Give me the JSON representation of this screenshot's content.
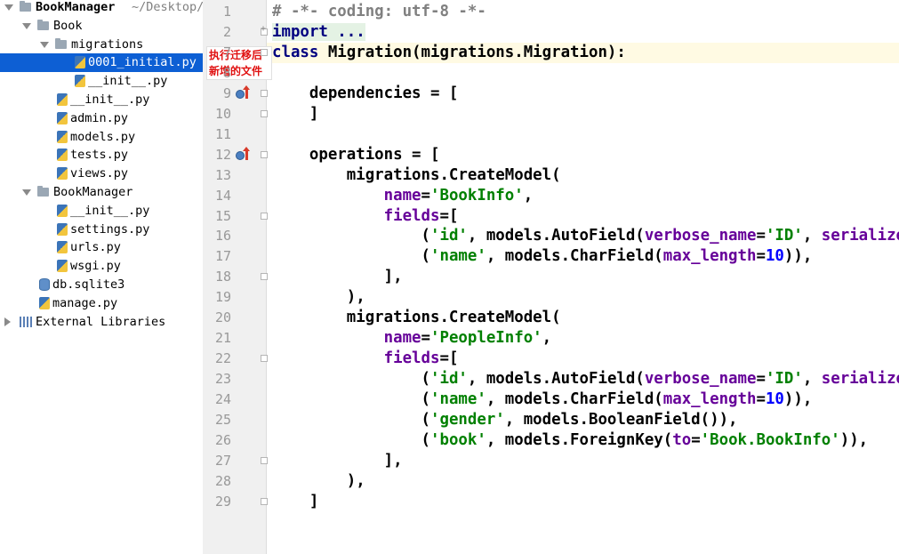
{
  "project_tree": [
    {
      "label": "BookManager",
      "detail": "~/Desktop/",
      "indent": 0,
      "kind": "folder",
      "expanded": true,
      "root": true,
      "selected": false,
      "name": "tree-root-bookmanager"
    },
    {
      "label": "Book",
      "indent": 1,
      "kind": "folder",
      "expanded": true,
      "selected": false,
      "name": "tree-folder-book"
    },
    {
      "label": "migrations",
      "indent": 2,
      "kind": "folder",
      "expanded": true,
      "selected": false,
      "name": "tree-folder-migrations"
    },
    {
      "label": "0001_initial.py",
      "indent": 4,
      "kind": "py",
      "selected": true,
      "name": "tree-file-0001-initial"
    },
    {
      "label": "__init__.py",
      "indent": 4,
      "kind": "py",
      "selected": false,
      "name": "tree-file-migrations-init"
    },
    {
      "label": "__init__.py",
      "indent": 3,
      "kind": "py",
      "selected": false,
      "name": "tree-file-book-init"
    },
    {
      "label": "admin.py",
      "indent": 3,
      "kind": "py",
      "selected": false,
      "name": "tree-file-admin"
    },
    {
      "label": "models.py",
      "indent": 3,
      "kind": "py",
      "selected": false,
      "name": "tree-file-models"
    },
    {
      "label": "tests.py",
      "indent": 3,
      "kind": "py",
      "selected": false,
      "name": "tree-file-tests"
    },
    {
      "label": "views.py",
      "indent": 3,
      "kind": "py",
      "selected": false,
      "name": "tree-file-views"
    },
    {
      "label": "BookManager",
      "indent": 1,
      "kind": "folder",
      "expanded": true,
      "selected": false,
      "name": "tree-folder-bookmanager"
    },
    {
      "label": "__init__.py",
      "indent": 3,
      "kind": "py",
      "selected": false,
      "name": "tree-file-bm-init"
    },
    {
      "label": "settings.py",
      "indent": 3,
      "kind": "py",
      "selected": false,
      "name": "tree-file-settings"
    },
    {
      "label": "urls.py",
      "indent": 3,
      "kind": "py",
      "selected": false,
      "name": "tree-file-urls"
    },
    {
      "label": "wsgi.py",
      "indent": 3,
      "kind": "py",
      "selected": false,
      "name": "tree-file-wsgi"
    },
    {
      "label": "db.sqlite3",
      "indent": 2,
      "kind": "db",
      "selected": false,
      "name": "tree-file-db"
    },
    {
      "label": "manage.py",
      "indent": 2,
      "kind": "py",
      "selected": false,
      "name": "tree-file-manage"
    },
    {
      "label": "External Libraries",
      "indent": 0,
      "kind": "lib",
      "expanded": false,
      "selected": false,
      "name": "tree-external-libraries"
    }
  ],
  "annotation": {
    "line1": "执行迁移后",
    "line2": "新增的文件",
    "color": "#e01010"
  },
  "editor": {
    "highlighted_line": 7,
    "lines": [
      {
        "num": "1",
        "fold": "none",
        "marker": false,
        "tokens": [
          [
            "com",
            "# -*- coding: utf-8 -*-"
          ]
        ]
      },
      {
        "num": "2",
        "fold": "plus",
        "marker": false,
        "tokens": [
          [
            "fold",
            "import ..."
          ]
        ]
      },
      {
        "num": "7",
        "fold": "open",
        "marker": false,
        "tokens": [
          [
            "kw",
            "class "
          ],
          [
            "txt",
            "Migration(migrations.Migration):"
          ]
        ]
      },
      {
        "num": "8",
        "fold": "none",
        "marker": false,
        "tokens": []
      },
      {
        "num": "9",
        "fold": "open",
        "marker": true,
        "tokens": [
          [
            "txt",
            "    dependencies = ["
          ]
        ]
      },
      {
        "num": "10",
        "fold": "close",
        "marker": false,
        "tokens": [
          [
            "txt",
            "    ]"
          ]
        ]
      },
      {
        "num": "11",
        "fold": "none",
        "marker": false,
        "tokens": []
      },
      {
        "num": "12",
        "fold": "open",
        "marker": true,
        "tokens": [
          [
            "txt",
            "    operations = ["
          ]
        ]
      },
      {
        "num": "13",
        "fold": "none",
        "marker": false,
        "tokens": [
          [
            "txt",
            "        migrations.CreateModel("
          ]
        ]
      },
      {
        "num": "14",
        "fold": "none",
        "marker": false,
        "tokens": [
          [
            "kwarg",
            "            name"
          ],
          [
            "txt",
            "="
          ],
          [
            "str",
            "'BookInfo'"
          ],
          [
            "txt",
            ","
          ]
        ]
      },
      {
        "num": "15",
        "fold": "open",
        "marker": false,
        "tokens": [
          [
            "kwarg",
            "            fields"
          ],
          [
            "txt",
            "=["
          ]
        ]
      },
      {
        "num": "16",
        "fold": "none",
        "marker": false,
        "tokens": [
          [
            "txt",
            "                ("
          ],
          [
            "str",
            "'id'"
          ],
          [
            "txt",
            ", models.AutoField("
          ],
          [
            "kwarg",
            "verbose_name"
          ],
          [
            "txt",
            "="
          ],
          [
            "str",
            "'ID'"
          ],
          [
            "txt",
            ", "
          ],
          [
            "kwarg",
            "serialize"
          ]
        ]
      },
      {
        "num": "17",
        "fold": "none",
        "marker": false,
        "tokens": [
          [
            "txt",
            "                ("
          ],
          [
            "str",
            "'name'"
          ],
          [
            "txt",
            ", models.CharField("
          ],
          [
            "kwarg",
            "max_length"
          ],
          [
            "txt",
            "="
          ],
          [
            "num",
            "10"
          ],
          [
            "txt",
            ")),"
          ]
        ]
      },
      {
        "num": "18",
        "fold": "close",
        "marker": false,
        "tokens": [
          [
            "txt",
            "            ],"
          ]
        ]
      },
      {
        "num": "19",
        "fold": "none",
        "marker": false,
        "tokens": [
          [
            "txt",
            "        ),"
          ]
        ]
      },
      {
        "num": "20",
        "fold": "none",
        "marker": false,
        "tokens": [
          [
            "txt",
            "        migrations.CreateModel("
          ]
        ]
      },
      {
        "num": "21",
        "fold": "none",
        "marker": false,
        "tokens": [
          [
            "kwarg",
            "            name"
          ],
          [
            "txt",
            "="
          ],
          [
            "str",
            "'PeopleInfo'"
          ],
          [
            "txt",
            ","
          ]
        ]
      },
      {
        "num": "22",
        "fold": "open",
        "marker": false,
        "tokens": [
          [
            "kwarg",
            "            fields"
          ],
          [
            "txt",
            "=["
          ]
        ]
      },
      {
        "num": "23",
        "fold": "none",
        "marker": false,
        "tokens": [
          [
            "txt",
            "                ("
          ],
          [
            "str",
            "'id'"
          ],
          [
            "txt",
            ", models.AutoField("
          ],
          [
            "kwarg",
            "verbose_name"
          ],
          [
            "txt",
            "="
          ],
          [
            "str",
            "'ID'"
          ],
          [
            "txt",
            ", "
          ],
          [
            "kwarg",
            "serialize"
          ]
        ]
      },
      {
        "num": "24",
        "fold": "none",
        "marker": false,
        "tokens": [
          [
            "txt",
            "                ("
          ],
          [
            "str",
            "'name'"
          ],
          [
            "txt",
            ", models.CharField("
          ],
          [
            "kwarg",
            "max_length"
          ],
          [
            "txt",
            "="
          ],
          [
            "num",
            "10"
          ],
          [
            "txt",
            ")),"
          ]
        ]
      },
      {
        "num": "25",
        "fold": "none",
        "marker": false,
        "tokens": [
          [
            "txt",
            "                ("
          ],
          [
            "str",
            "'gender'"
          ],
          [
            "txt",
            ", models.BooleanField()),"
          ]
        ]
      },
      {
        "num": "26",
        "fold": "none",
        "marker": false,
        "tokens": [
          [
            "txt",
            "                ("
          ],
          [
            "str",
            "'book'"
          ],
          [
            "txt",
            ", models.ForeignKey("
          ],
          [
            "kwarg",
            "to"
          ],
          [
            "txt",
            "="
          ],
          [
            "str",
            "'Book.BookInfo'"
          ],
          [
            "txt",
            ")),"
          ]
        ]
      },
      {
        "num": "27",
        "fold": "close",
        "marker": false,
        "tokens": [
          [
            "txt",
            "            ],"
          ]
        ]
      },
      {
        "num": "28",
        "fold": "none",
        "marker": false,
        "tokens": [
          [
            "txt",
            "        ),"
          ]
        ]
      },
      {
        "num": "29",
        "fold": "close",
        "marker": false,
        "tokens": [
          [
            "txt",
            "    ]"
          ]
        ]
      }
    ]
  }
}
